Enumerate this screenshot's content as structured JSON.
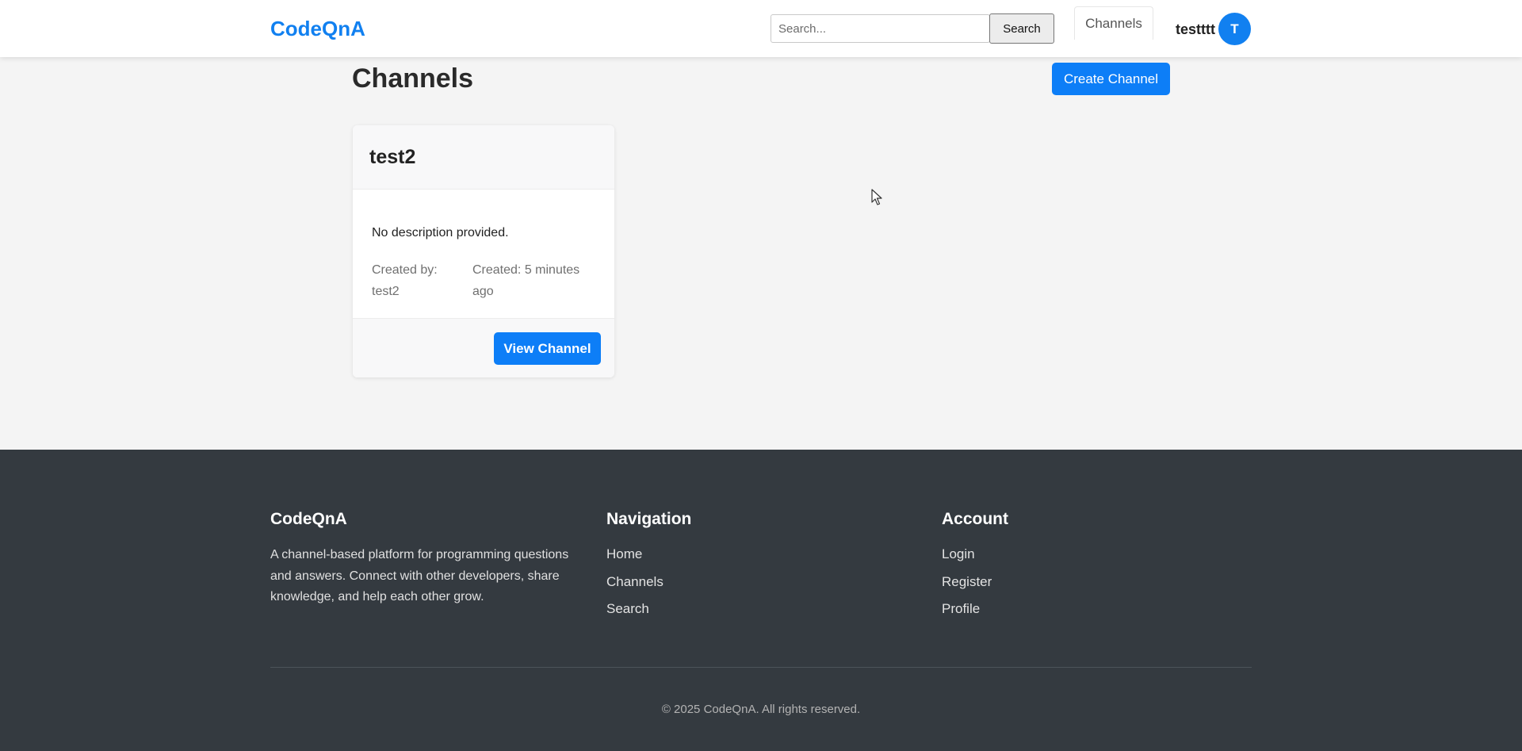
{
  "header": {
    "logo": "CodeQnA",
    "search": {
      "placeholder": "Search...",
      "value": ""
    },
    "search_button": "Search",
    "nav_channels": "Channels",
    "user": {
      "name": "testttt",
      "avatar_initial": "T"
    }
  },
  "main": {
    "title": "Channels",
    "create_button": "Create Channel",
    "channels": [
      {
        "name": "test2",
        "description": "No description provided.",
        "created_by": "Created by: test2",
        "created_at": "Created: 5 minutes ago",
        "view_button": "View Channel"
      }
    ]
  },
  "footer": {
    "brand": {
      "title": "CodeQnA",
      "description": "A channel-based platform for programming questions and answers. Connect with other developers, share knowledge, and help each other grow."
    },
    "navigation": {
      "title": "Navigation",
      "links": [
        "Home",
        "Channels",
        "Search"
      ]
    },
    "account": {
      "title": "Account",
      "links": [
        "Login",
        "Register",
        "Profile"
      ]
    },
    "copyright": "© 2025 CodeQnA. All rights reserved."
  },
  "colors": {
    "brand": "#1180f0",
    "primary_button": "#0d7ef7",
    "footer_bg": "#343a40",
    "page_bg": "#f4f4f4"
  },
  "icons": [
    "mouse-pointer-icon"
  ]
}
